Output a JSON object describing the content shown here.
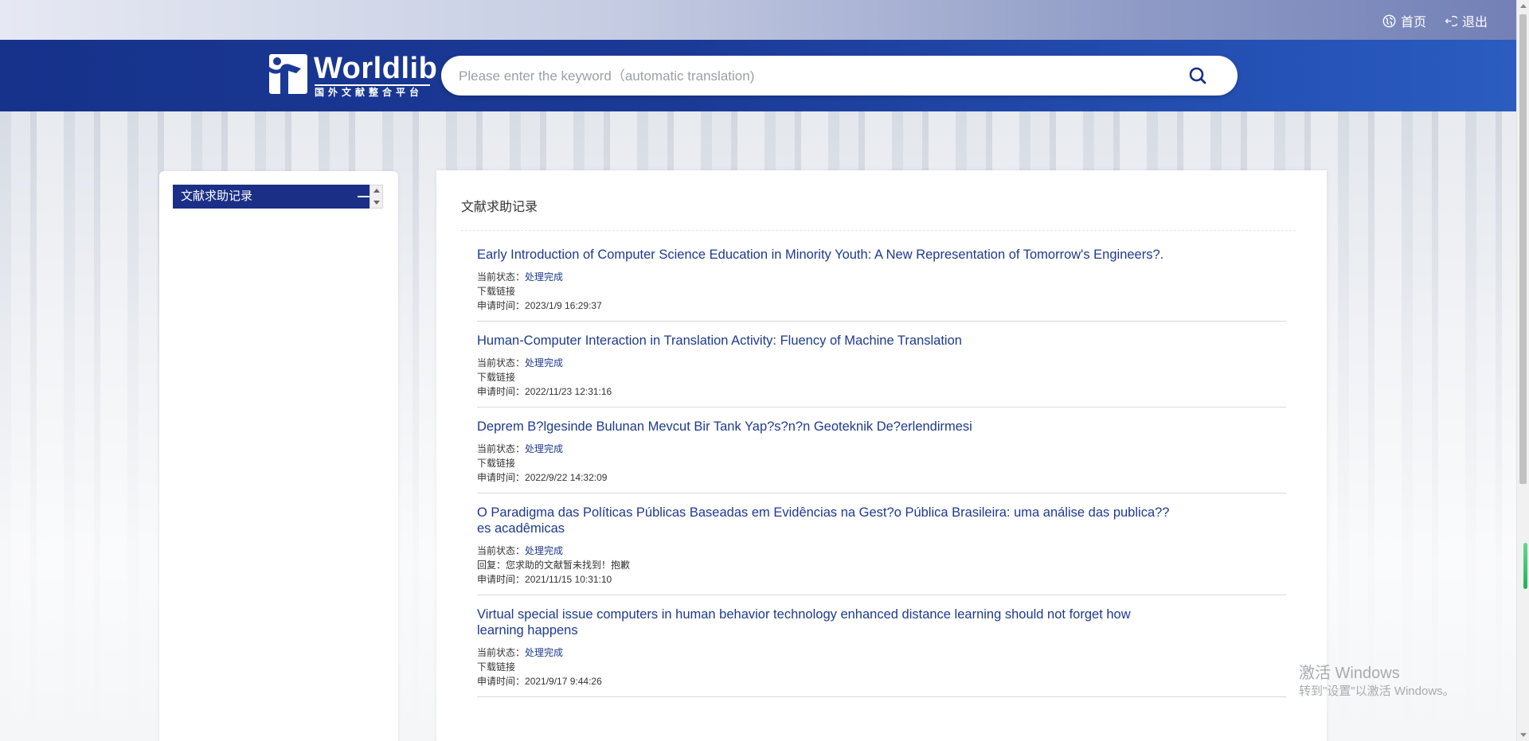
{
  "top_nav": {
    "home_label": "首页",
    "logout_label": "退出",
    "home_icon": "globe-icon",
    "logout_icon": "logout-icon"
  },
  "header": {
    "logo_text": "Worldlib",
    "logo_subtitle": "国外文献整合平台",
    "search_placeholder": "Please enter the keyword（automatic translation)",
    "search_value": "",
    "search_icon": "search-icon"
  },
  "sidebar": {
    "items": [
      {
        "label": "文献求助记录"
      }
    ]
  },
  "main": {
    "title": "文献求助记录",
    "status_label": "当前状态：",
    "time_label": "申请时间：",
    "records": [
      {
        "title": "Early Introduction of Computer Science Education in Minority Youth: A New Representation of Tomorrow's Engineers?.",
        "status": "处理完成",
        "second_line": "下载链接",
        "time": "2023/1/9 16:29:37"
      },
      {
        "title": "Human-Computer Interaction in Translation Activity: Fluency of Machine Translation",
        "status": "处理完成",
        "second_line": "下载链接",
        "time": "2022/11/23 12:31:16"
      },
      {
        "title": "Deprem B?lgesinde Bulunan Mevcut Bir Tank Yap?s?n?n Geoteknik De?erlendirmesi",
        "status": "处理完成",
        "second_line": "下载链接",
        "time": "2022/9/22 14:32:09"
      },
      {
        "title": "O Paradigma das Políticas Públicas Baseadas em Evidências na Gest?o Pública Brasileira: uma análise das publica??es acadêmicas",
        "status": "处理完成",
        "second_line": "回复：您求助的文献暂未找到！抱歉",
        "time": "2021/11/15 10:31:10"
      },
      {
        "title": "Virtual special issue computers in human behavior technology enhanced distance learning should not forget how learning happens",
        "status": "处理完成",
        "second_line": "下载链接",
        "time": "2021/9/17 9:44:26"
      }
    ]
  },
  "watermark": {
    "title": "激活 Windows",
    "subtitle": "转到\"设置\"以激活 Windows。"
  }
}
